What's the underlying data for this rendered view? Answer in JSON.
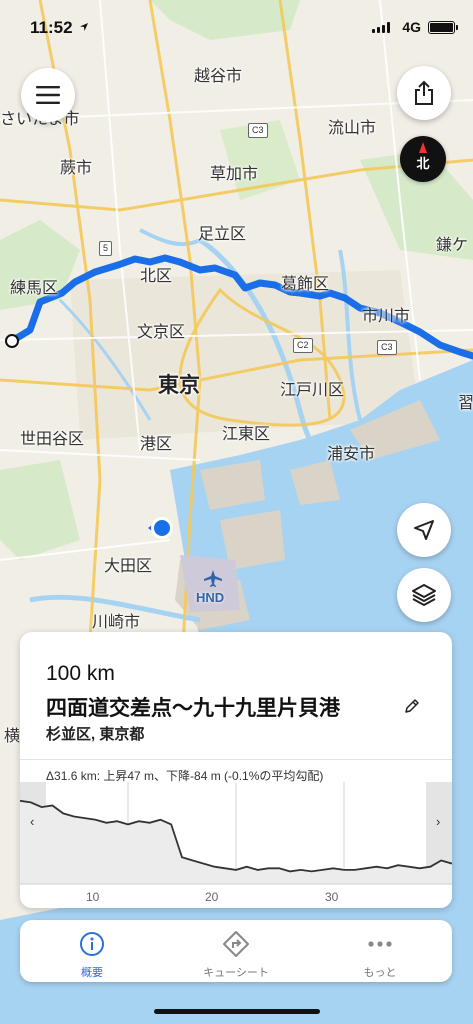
{
  "status_bar": {
    "time": "11:52",
    "network": "4G"
  },
  "map": {
    "labels": [
      {
        "text": "越谷市"
      },
      {
        "text": "さいたま市"
      },
      {
        "text": "流山市"
      },
      {
        "text": "蕨市"
      },
      {
        "text": "草加市"
      },
      {
        "text": "足立区"
      },
      {
        "text": "鎌ケ"
      },
      {
        "text": "練馬区"
      },
      {
        "text": "北区"
      },
      {
        "text": "葛飾区"
      },
      {
        "text": "市川市"
      },
      {
        "text": "文京区"
      },
      {
        "text": "東京"
      },
      {
        "text": "江戸川区"
      },
      {
        "text": "習"
      },
      {
        "text": "世田谷区"
      },
      {
        "text": "港区"
      },
      {
        "text": "江東区"
      },
      {
        "text": "浦安市"
      },
      {
        "text": "大田区"
      },
      {
        "text": "川崎市"
      },
      {
        "text": "横"
      }
    ],
    "road_badges": [
      "C3",
      "5",
      "C2",
      "C3"
    ],
    "airport": "HND",
    "route_color": "#1a6fe8"
  },
  "compass": {
    "label": "北"
  },
  "card": {
    "distance": "100 km",
    "route_name": "四面道交差点〜九十九里片貝港",
    "region": "杉並区, 東京都",
    "summary": "Δ31.6 km: 上昇47 m、下降-84 m (-0.1%の平均勾配)",
    "prev_arrow": "‹",
    "next_arrow": "›"
  },
  "chart_data": {
    "type": "area",
    "xlabel": "",
    "ylabel": "",
    "xlim": [
      0,
      40
    ],
    "x_ticks": [
      "10",
      "20",
      "30"
    ],
    "x": [
      0,
      1,
      2,
      3,
      4,
      5,
      6,
      7,
      8,
      9,
      10,
      11,
      12,
      13,
      14,
      15,
      16,
      17,
      18,
      19,
      20,
      21,
      22,
      23,
      24,
      25,
      26,
      27,
      28,
      29,
      30,
      31,
      32,
      33,
      34,
      35,
      36,
      37,
      38,
      39,
      40
    ],
    "values": [
      48,
      47,
      44,
      45,
      40,
      38,
      37,
      36,
      34,
      35,
      33,
      35,
      34,
      36,
      33,
      12,
      10,
      8,
      6,
      5,
      4,
      6,
      4,
      5,
      5,
      3,
      4,
      3,
      4,
      5,
      4,
      4,
      5,
      6,
      5,
      7,
      6,
      5,
      6,
      10,
      8
    ]
  },
  "tabs": [
    {
      "label": "概要"
    },
    {
      "label": "キューシート"
    },
    {
      "label": "もっと"
    }
  ],
  "colors": {
    "accent": "#2a6fdb",
    "water": "#a7d3f2",
    "land": "#f1eee6"
  }
}
